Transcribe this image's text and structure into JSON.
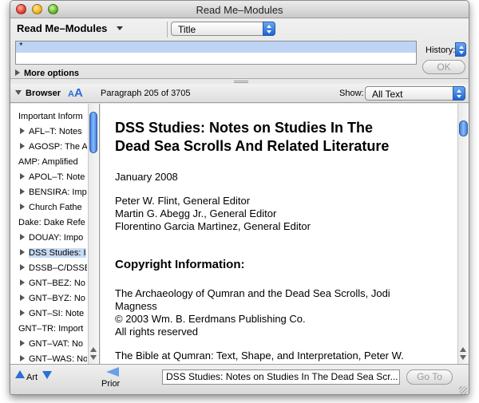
{
  "window": {
    "title": "Read Me–Modules"
  },
  "search": {
    "module_label": "Read Me–Modules",
    "field_select": "Title",
    "query": "*",
    "history_label": "History:",
    "ok_label": "OK",
    "more_options": "More options"
  },
  "browser": {
    "label": "Browser",
    "font_small": "A",
    "font_big": "A",
    "paragraph_label": "Paragraph 205  of 3705",
    "show_label": "Show:",
    "show_value": "All Text"
  },
  "sidebar": {
    "items": [
      {
        "label": "Important Inform",
        "type": "top"
      },
      {
        "label": "AFL–T: Notes",
        "type": "child"
      },
      {
        "label": "AGOSP: The A",
        "type": "child"
      },
      {
        "label": "AMP: Amplified",
        "type": "top"
      },
      {
        "label": "APOL–T: Note",
        "type": "child"
      },
      {
        "label": "BENSIRA: Imp",
        "type": "child"
      },
      {
        "label": "Church Fathe",
        "type": "child"
      },
      {
        "label": "Dake: Dake Refe",
        "type": "top"
      },
      {
        "label": "DOUAY: Impo",
        "type": "child"
      },
      {
        "label": "DSS Studies: I",
        "type": "child",
        "selected": true
      },
      {
        "label": "DSSB–C/DSSB",
        "type": "child"
      },
      {
        "label": "GNT–BEZ: No",
        "type": "child"
      },
      {
        "label": "GNT–BYZ: No",
        "type": "child"
      },
      {
        "label": "GNT–SI: Note",
        "type": "child"
      },
      {
        "label": "GNT–TR: Import",
        "type": "top"
      },
      {
        "label": "GNT–VAT: No",
        "type": "child"
      },
      {
        "label": "GNT–WAS: No",
        "type": "child"
      }
    ]
  },
  "content": {
    "title_line1": "DSS Studies: Notes on Studies In The",
    "title_line2": "Dead Sea Scrolls And Related Literature",
    "date": "January 2008",
    "editor1": "Peter W. Flint, General Editor",
    "editor2": "Martin G. Abegg Jr., General Editor",
    "editor3": "Florentino Garcia Martìnez, General Editor",
    "copyright_heading": "Copyright Information:",
    "book1_line1": "The Archaeology of Qumran and the Dead Sea Scrolls, Jodi",
    "book1_line2": "Magness",
    "book1_line3": "© 2003 Wm. B. Eerdmans Publishing Co.",
    "book1_line4": "All rights reserved",
    "book2_line1": "The Bible at Qumran: Text, Shape, and Interpretation, Peter W."
  },
  "bottom": {
    "art_label": "Art",
    "prior_label": "Prior",
    "nav_field": "DSS Studies: Notes on Studies In The Dead Sea Scr...",
    "goto_label": "Go To"
  }
}
